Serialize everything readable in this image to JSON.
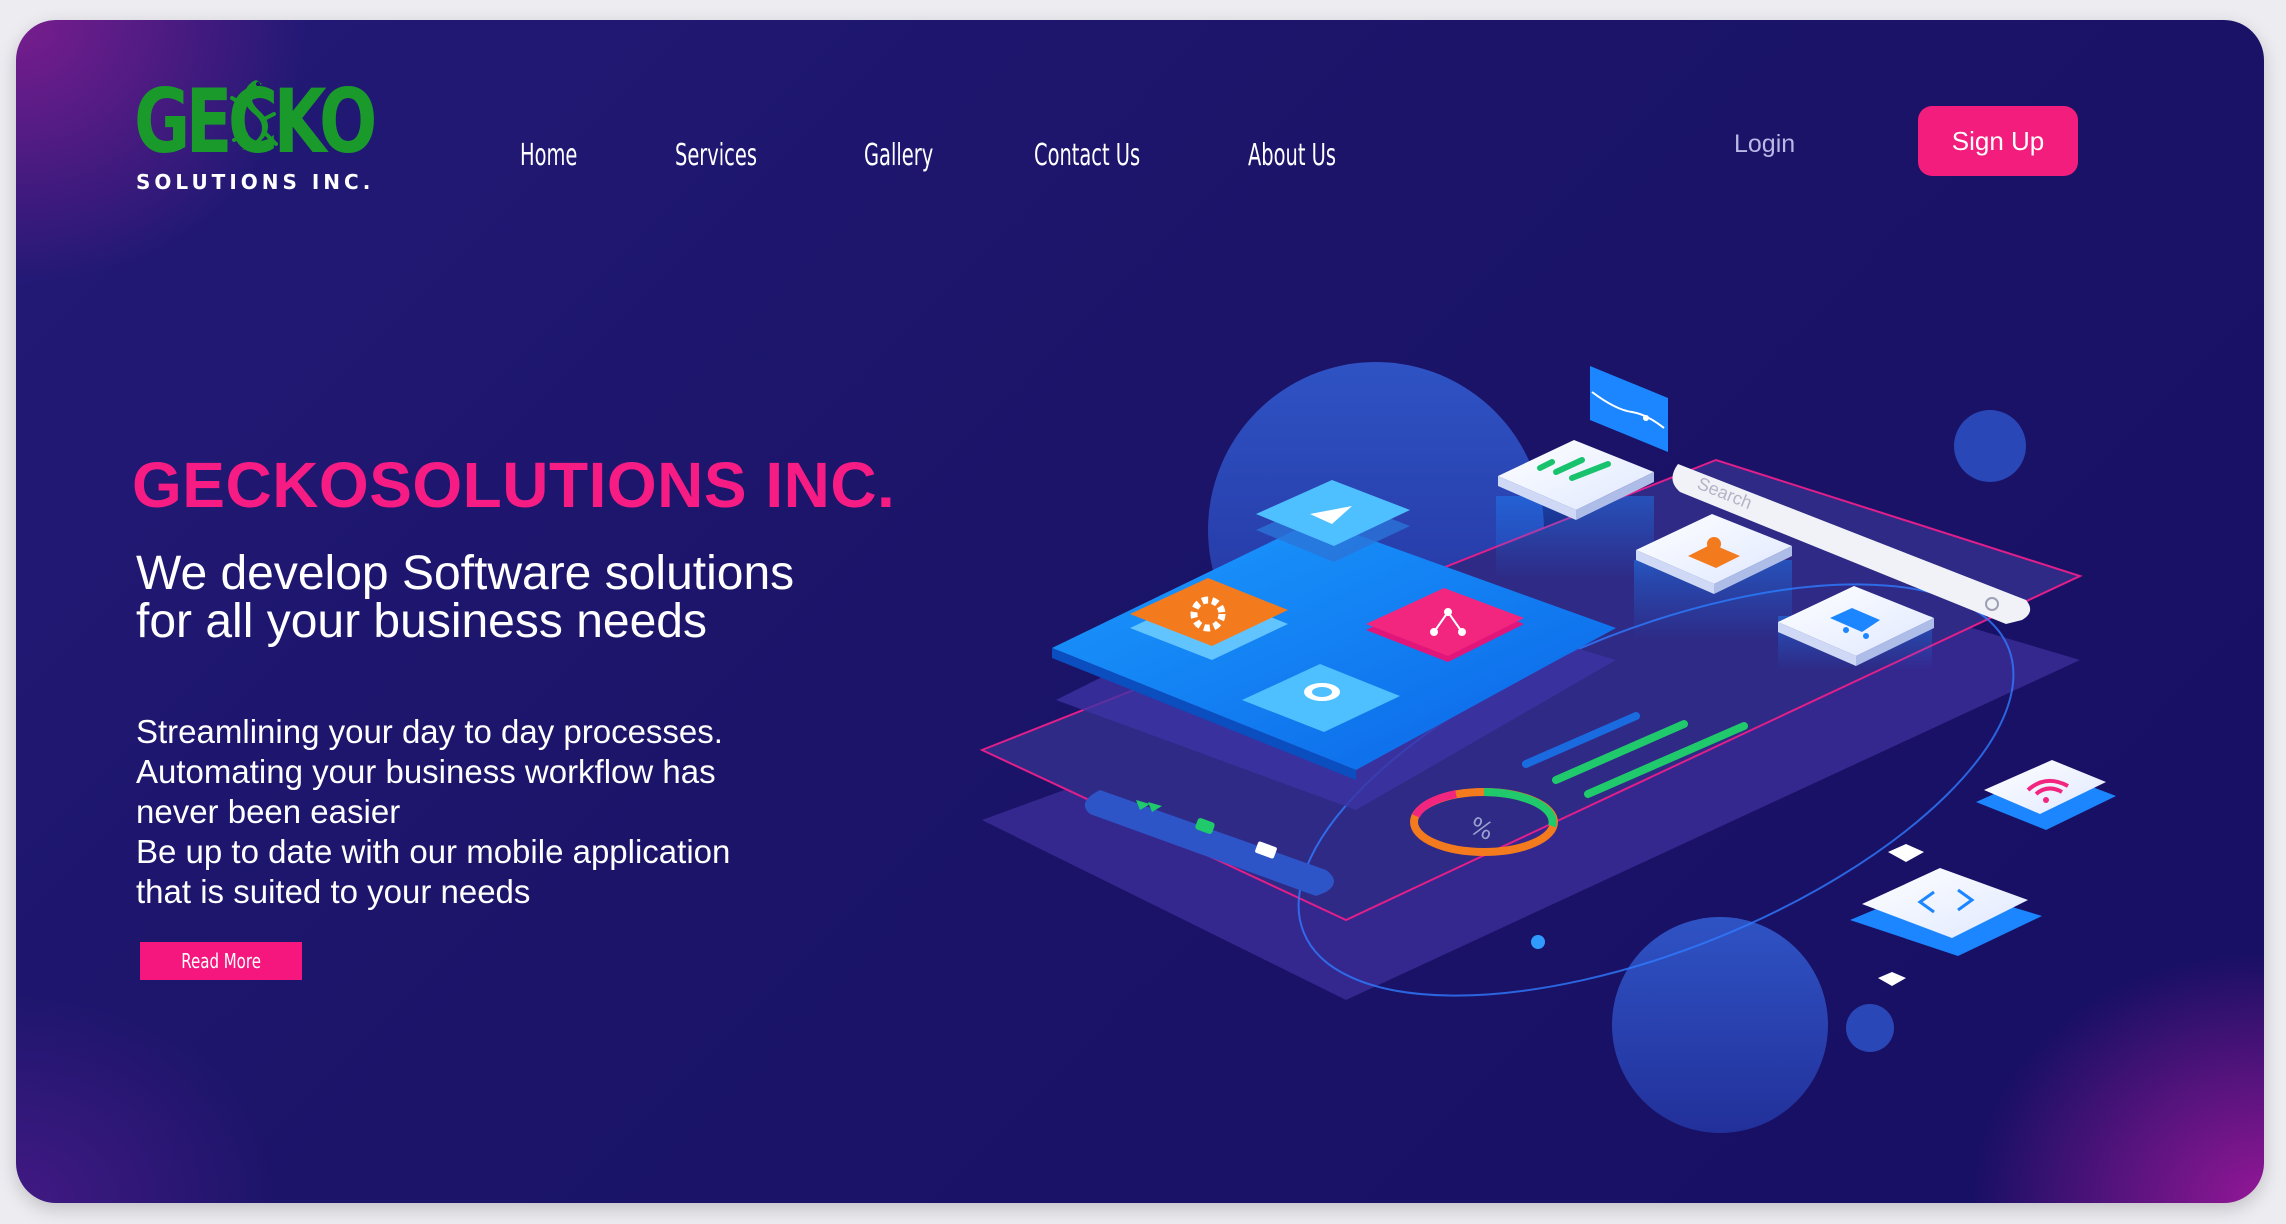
{
  "logo": {
    "wordmark": "GECKO",
    "subtitle": "SOLUTIONS INC.",
    "wordmark_color": "#1a9a2a"
  },
  "nav": {
    "items": [
      {
        "label": "Home"
      },
      {
        "label": "Services"
      },
      {
        "label": "Gallery"
      },
      {
        "label": "Contact Us"
      },
      {
        "label": "About Us"
      }
    ],
    "login_label": "Login",
    "signup_label": "Sign Up"
  },
  "hero": {
    "title": "GECKOSOLUTIONS INC.",
    "subtitle_lines": [
      "We develop Software solutions",
      "for all your business needs"
    ],
    "description_lines": [
      "Streamlining your day to day processes.",
      "Automating your business workflow has",
      "never been easier",
      "Be up to date with our mobile application",
      "that is suited to your needs"
    ],
    "read_more_label": "Read More"
  },
  "illustration": {
    "search_placeholder": "Search",
    "tile_icons": [
      "play-icon",
      "gear-icon",
      "share-icon",
      "location-icon",
      "bar-chart-icon",
      "users-icon",
      "shopping-cart-icon",
      "wifi-icon",
      "code-icon",
      "percent-icon"
    ]
  },
  "colors": {
    "accent": "#f21d7c",
    "background": "#1b1468",
    "text": "#ffffff",
    "login_text": "#b9b8e6"
  }
}
